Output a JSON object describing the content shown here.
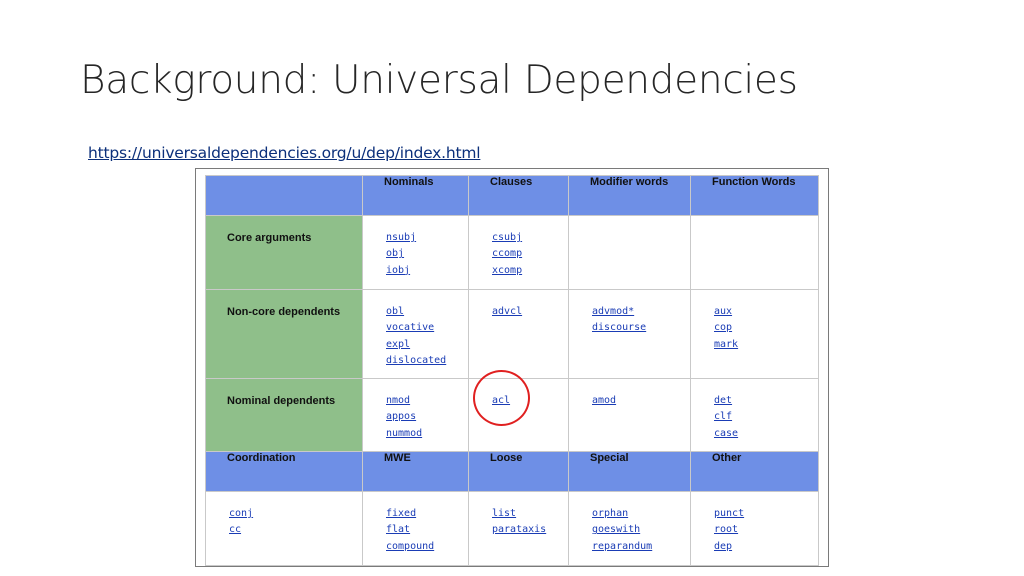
{
  "slide": {
    "title": "Background: Universal Dependencies",
    "link": "https://universaldependencies.org/u/dep/index.html"
  },
  "table": {
    "headers": [
      "Nominals",
      "Clauses",
      "Modifier words",
      "Function Words"
    ],
    "rows": [
      {
        "label": "Core arguments",
        "cells": [
          [
            "nsubj",
            "obj",
            "iobj"
          ],
          [
            "csubj",
            "ccomp",
            "xcomp"
          ],
          [],
          []
        ]
      },
      {
        "label": "Non-core dependents",
        "cells": [
          [
            "obl",
            "vocative",
            "expl",
            "dislocated"
          ],
          [
            "advcl"
          ],
          [
            "advmod*",
            "discourse"
          ],
          [
            "aux",
            "cop",
            "mark"
          ]
        ]
      },
      {
        "label": "Nominal dependents",
        "cells": [
          [
            "nmod",
            "appos",
            "nummod"
          ],
          [
            "acl"
          ],
          [
            "amod"
          ],
          [
            "det",
            "clf",
            "case"
          ]
        ]
      }
    ],
    "headers2": [
      "Coordination",
      "MWE",
      "Loose",
      "Special",
      "Other"
    ],
    "bottom_cells": [
      [
        "conj",
        "cc"
      ],
      [
        "fixed",
        "flat",
        "compound"
      ],
      [
        "list",
        "parataxis"
      ],
      [
        "orphan",
        "goeswith",
        "reparandum"
      ],
      [
        "punct",
        "root",
        "dep"
      ]
    ]
  },
  "colors": {
    "header_blue": "#6e8fe6",
    "row_label_green": "#8fbf8a",
    "link_blue": "#1a3cb5",
    "highlight_circle": "#e02020"
  }
}
